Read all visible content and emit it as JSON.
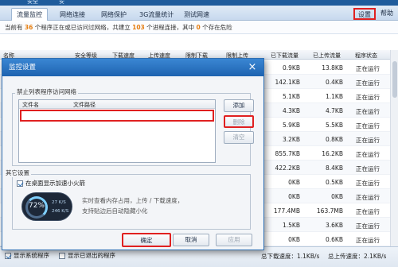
{
  "window": {
    "title_fragment_left": "安全",
    "title_fragment_right": "安"
  },
  "tabs": [
    "流量监控",
    "网络连接",
    "网络保护",
    "3G流量统计",
    "测试网速"
  ],
  "active_tab_index": 0,
  "header_links": {
    "settings": "设置",
    "help": "帮助"
  },
  "info": {
    "prefix": "当前有",
    "program_count": "36",
    "mid1": "个程序正在或已访问过网络，共建立",
    "connection_count": "103",
    "mid2": "个进程连接，其中",
    "danger_count": "0",
    "suffix": "个存在危险"
  },
  "table": {
    "columns": [
      "名称",
      "安全等级",
      "下载速度",
      "上传速度",
      "限制下载",
      "限制上传",
      "已下载流量",
      "已上传流量",
      "程序状态"
    ],
    "rows": [
      {
        "downloaded": "0.9KB",
        "uploaded": "13.8KB",
        "status": "正在运行"
      },
      {
        "downloaded": "142.1KB",
        "uploaded": "0.4KB",
        "status": "正在运行"
      },
      {
        "downloaded": "5.1KB",
        "uploaded": "1.1KB",
        "status": "正在运行"
      },
      {
        "downloaded": "4.3KB",
        "uploaded": "4.7KB",
        "status": "正在运行"
      },
      {
        "downloaded": "5.9KB",
        "uploaded": "5.5KB",
        "status": "正在运行"
      },
      {
        "downloaded": "3.2KB",
        "uploaded": "0.8KB",
        "status": "正在运行"
      },
      {
        "downloaded": "855.7KB",
        "uploaded": "16.2KB",
        "status": "正在运行"
      },
      {
        "downloaded": "422.2KB",
        "uploaded": "8.4KB",
        "status": "正在运行"
      },
      {
        "downloaded": "0KB",
        "uploaded": "0.5KB",
        "status": "正在运行"
      },
      {
        "downloaded": "0KB",
        "uploaded": "0KB",
        "status": "正在运行"
      },
      {
        "downloaded": "177.4MB",
        "uploaded": "163.7MB",
        "status": "正在运行"
      },
      {
        "downloaded": "1.5KB",
        "uploaded": "3.6KB",
        "status": "正在运行"
      },
      {
        "downloaded": "0KB",
        "uploaded": "0.6KB",
        "status": "正在运行"
      }
    ]
  },
  "dialog": {
    "title": "监控设置",
    "close_glyph": "×",
    "group1_label": "禁止列表程序访问网络",
    "list_columns": [
      "文件名",
      "文件路径"
    ],
    "add_button": "添加",
    "delete_button": "删除",
    "clear_button": "清空",
    "group2_label": "其它设置",
    "desktop_option": "在桌面显示加速小火箭",
    "gauge": {
      "percent": "72%",
      "up_speed": "27 K/S",
      "down_speed": "246 K/S"
    },
    "desc_line1": "实时查看内存占用，上传 / 下载速度，",
    "desc_line2": "支持贴边后自动隐藏小化",
    "ok_button": "确定",
    "cancel_button": "取消",
    "apply_button": "应用"
  },
  "footer": {
    "show_system_programs": "显示系统程序",
    "show_exited_programs": "显示已退出的程序",
    "down_label": "总下载速度：",
    "down_value": "1.1KB/s",
    "up_label": "总上传速度：",
    "up_value": "2.1KB/s"
  }
}
